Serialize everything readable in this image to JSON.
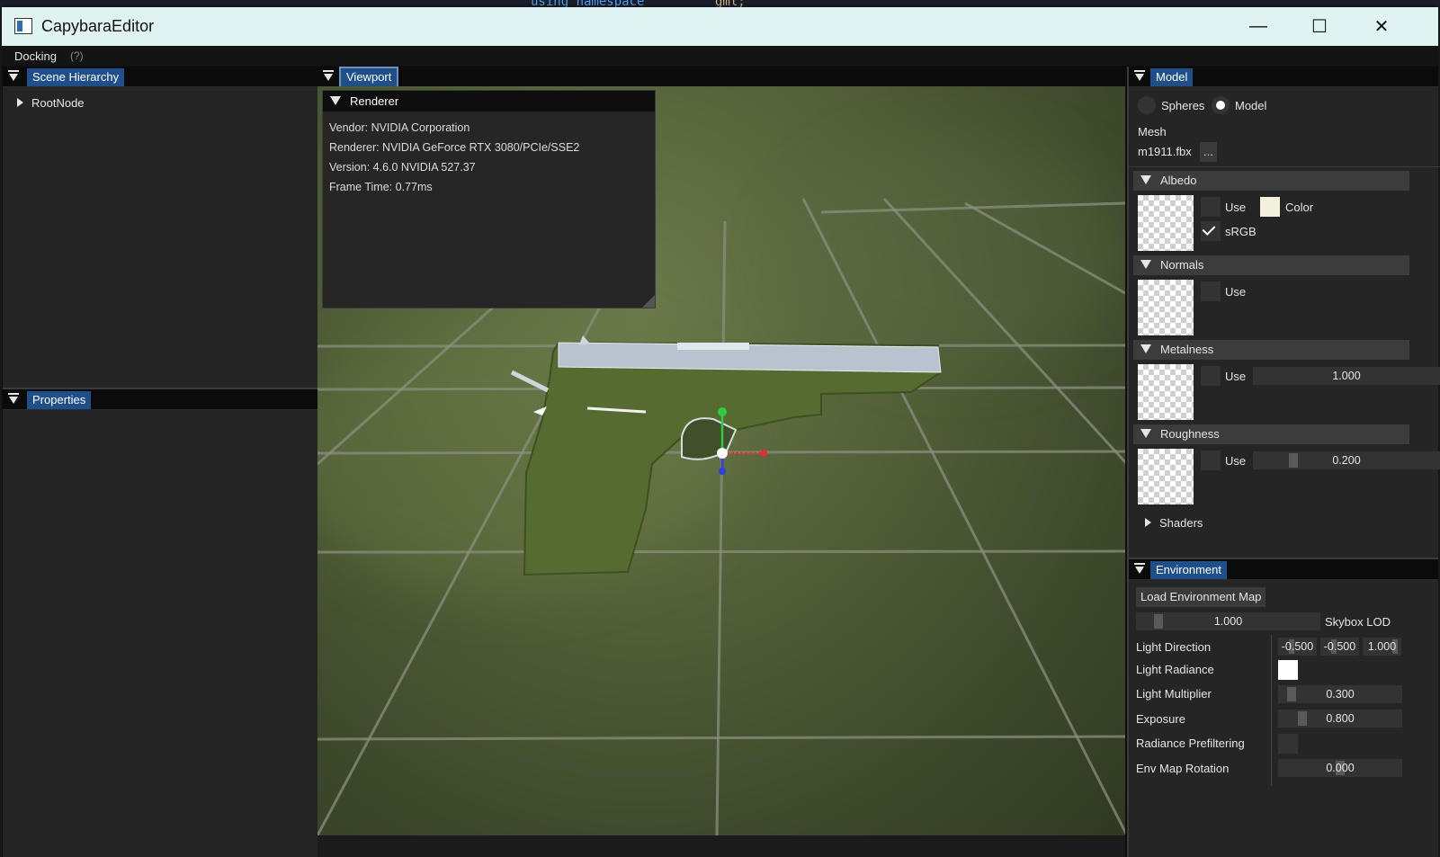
{
  "background_app": {
    "code_left": "using namespace",
    "code_right": "gml;"
  },
  "window": {
    "title": "CapybaraEditor",
    "minimize": "—",
    "maximize": "☐",
    "close": "✕"
  },
  "menubar": {
    "docking": "Docking",
    "help": "(?)"
  },
  "scene_hierarchy": {
    "tab": "Scene Hierarchy",
    "root": "RootNode"
  },
  "properties": {
    "tab": "Properties"
  },
  "viewport": {
    "tab": "Viewport",
    "renderer": {
      "title": "Renderer",
      "vendor": "Vendor: NVIDIA Corporation",
      "renderer": "Renderer: NVIDIA GeForce RTX 3080/PCIe/SSE2",
      "version": "Version: 4.6.0 NVIDIA 527.37",
      "frame_time": "Frame Time: 0.77ms"
    }
  },
  "model": {
    "tab": "Model",
    "radio_spheres": "Spheres",
    "radio_model": "Model",
    "selected": "Model",
    "mesh_label": "Mesh",
    "mesh_file": "m1911.fbx",
    "browse": "...",
    "albedo": {
      "title": "Albedo",
      "use": "Use",
      "color": "Color",
      "color_hex": "#f3f1de",
      "srgb": "sRGB",
      "srgb_checked": true
    },
    "normals": {
      "title": "Normals",
      "use": "Use"
    },
    "metalness": {
      "title": "Metalness",
      "use": "Use",
      "value": "1.000"
    },
    "roughness": {
      "title": "Roughness",
      "use": "Use",
      "value": "0.200"
    },
    "shaders": "Shaders"
  },
  "environment": {
    "tab": "Environment",
    "load_button": "Load Environment Map",
    "skybox_lod_value": "1.000",
    "skybox_lod_label": "Skybox LOD",
    "light_direction_label": "Light Direction",
    "light_direction": [
      "-0.500",
      "-0.500",
      "1.000"
    ],
    "light_radiance_label": "Light Radiance",
    "light_radiance_color": "#ffffff",
    "light_multiplier_label": "Light Multiplier",
    "light_multiplier": "0.300",
    "exposure_label": "Exposure",
    "exposure": "0.800",
    "radiance_prefiltering_label": "Radiance Prefiltering",
    "env_map_rotation_label": "Env Map Rotation",
    "env_map_rotation": "0.000"
  },
  "colors": {
    "tab_active": "#1f4f8a",
    "titlebar": "#dff3f3",
    "panel": "#252525"
  }
}
